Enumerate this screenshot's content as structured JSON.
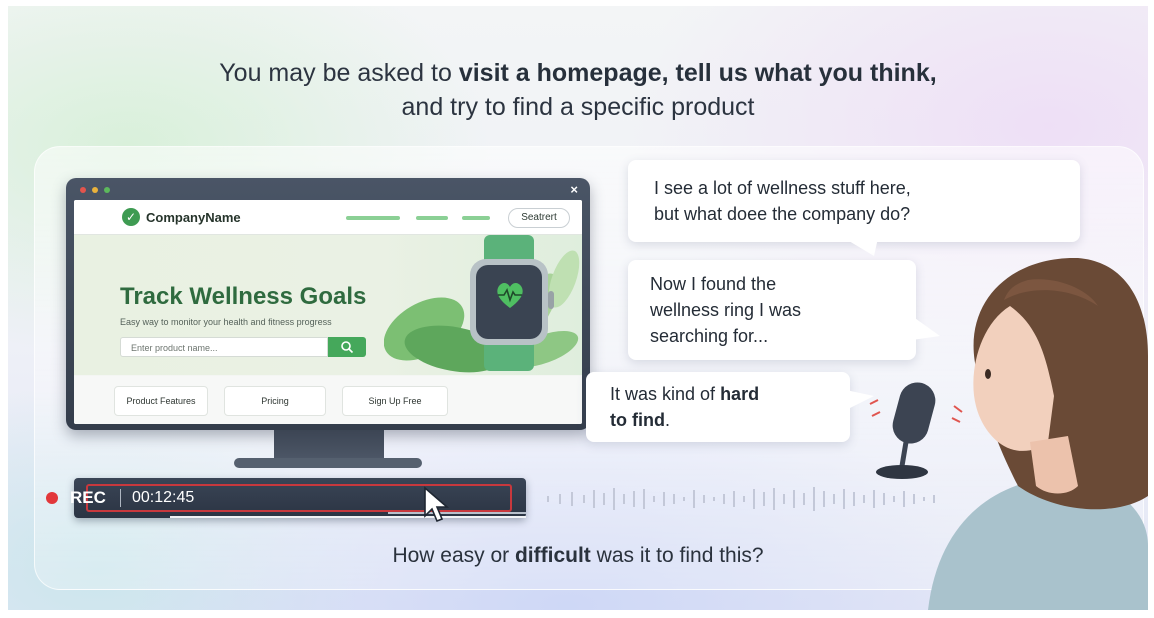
{
  "headline": {
    "line1_a": "You may be asked to ",
    "line1_b": "visit a homepage, tell us what you think,",
    "line2": "and try to find a specific product"
  },
  "monitor_site": {
    "close_glyph": "×",
    "company_name": "CompanyName",
    "search_button": "Seatrert",
    "hero_title": "Track Wellness Goals",
    "hero_subtitle": "Easy way to monitor your health and fitness progress",
    "search_placeholder": "Enter product name...",
    "cards": [
      "Product Features",
      "Pricing",
      "Sign Up Free"
    ]
  },
  "recording": {
    "label": "REC",
    "time": "00:12:45"
  },
  "bubbles": {
    "b1_line1": "I see a lot of wellness stuff here,",
    "b1_line2": "but what doee the company do?",
    "b2_line1": "Now I found the",
    "b2_line2": "wellness ring I was",
    "b2_line3": "searching for...",
    "b3_line1_a": "It was kind of ",
    "b3_line1_b": "hard",
    "b3_line2_a": "to find",
    "b3_line2_b": "."
  },
  "question": {
    "a": "How easy or ",
    "b": "difficult",
    "c": " was it to find this?"
  },
  "colors": {
    "brand_green": "#45a85b",
    "rec_red": "#e2373a",
    "dark_ui": "#343d4b"
  },
  "icons": [
    "check-icon",
    "search-icon",
    "heart-rate-icon",
    "cursor-arrow-icon",
    "microphone-icon"
  ]
}
